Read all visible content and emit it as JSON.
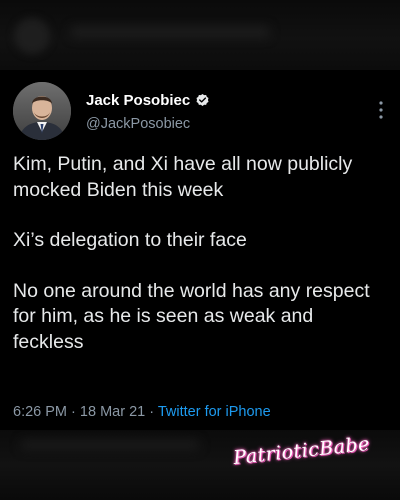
{
  "tweet": {
    "author": {
      "display_name": "Jack Posobiec",
      "handle": "@JackPosobiec",
      "verified_icon": "verified-badge-icon"
    },
    "paragraphs": [
      "Kim, Putin, and Xi have all now publicly mocked Biden this week",
      "Xi’s delegation to their face",
      "No one around the world has any respect for him, as he is seen as weak and feckless"
    ],
    "time": "6:26 PM",
    "separator": "·",
    "date": "18 Mar 21",
    "source": "Twitter for iPhone"
  },
  "watermark": {
    "text": "PatrioticBabe"
  },
  "colors": {
    "background": "#000000",
    "text": "#e7e9ea",
    "secondary": "#8b98a5",
    "link": "#1d9bf0",
    "watermark_glow": "#ff66c4"
  }
}
